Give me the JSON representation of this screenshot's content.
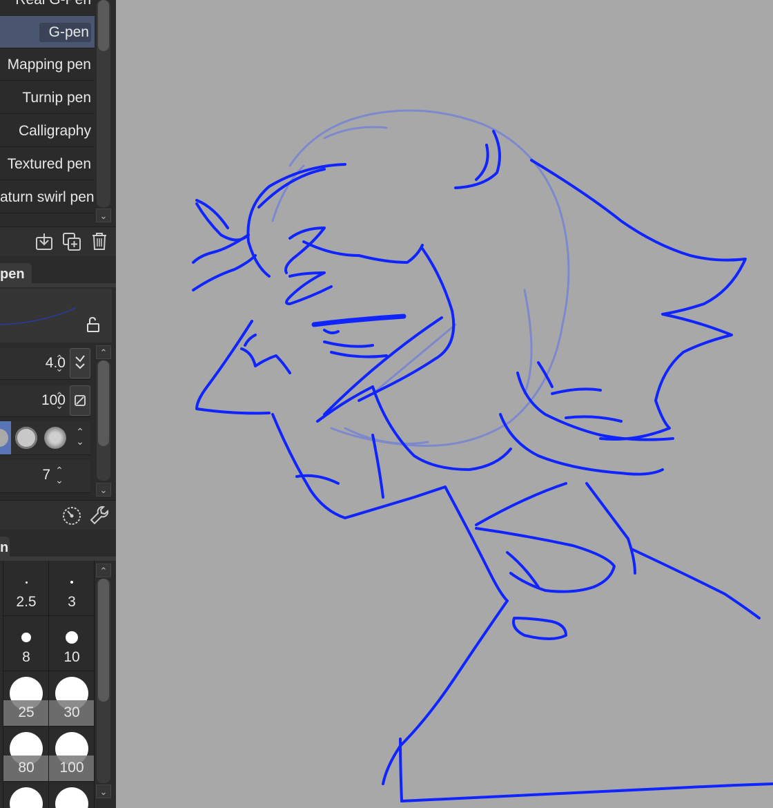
{
  "brushes": {
    "items": [
      {
        "label": "Real G-Pen"
      },
      {
        "label": "G-pen",
        "selected": true
      },
      {
        "label": "Mapping pen"
      },
      {
        "label": "Turnip pen"
      },
      {
        "label": "Calligraphy"
      },
      {
        "label": "Textured pen"
      },
      {
        "label": "aturn swirl pen"
      }
    ]
  },
  "tool_property": {
    "tab_label": "pen",
    "brush_size_value": "4.0",
    "opacity_value": "100",
    "stabilization_value": "7"
  },
  "brush_size_palette": {
    "tab_label": "n",
    "sizes": [
      "2.5",
      "3",
      "8",
      "10",
      "25",
      "30",
      "80",
      "100"
    ]
  },
  "colors": {
    "panel_bg": "#2b2b2b",
    "selected_item": "#4b5670",
    "canvas_bg": "#a8a8a8",
    "stroke_color": "#1a2cff"
  },
  "icons": [
    "chevron-down-icon",
    "import-icon",
    "duplicate-icon",
    "trash-icon",
    "unlock-icon",
    "sync-icon",
    "pressure-icon",
    "gauge-icon",
    "wrench-icon",
    "chevron-up-icon"
  ]
}
